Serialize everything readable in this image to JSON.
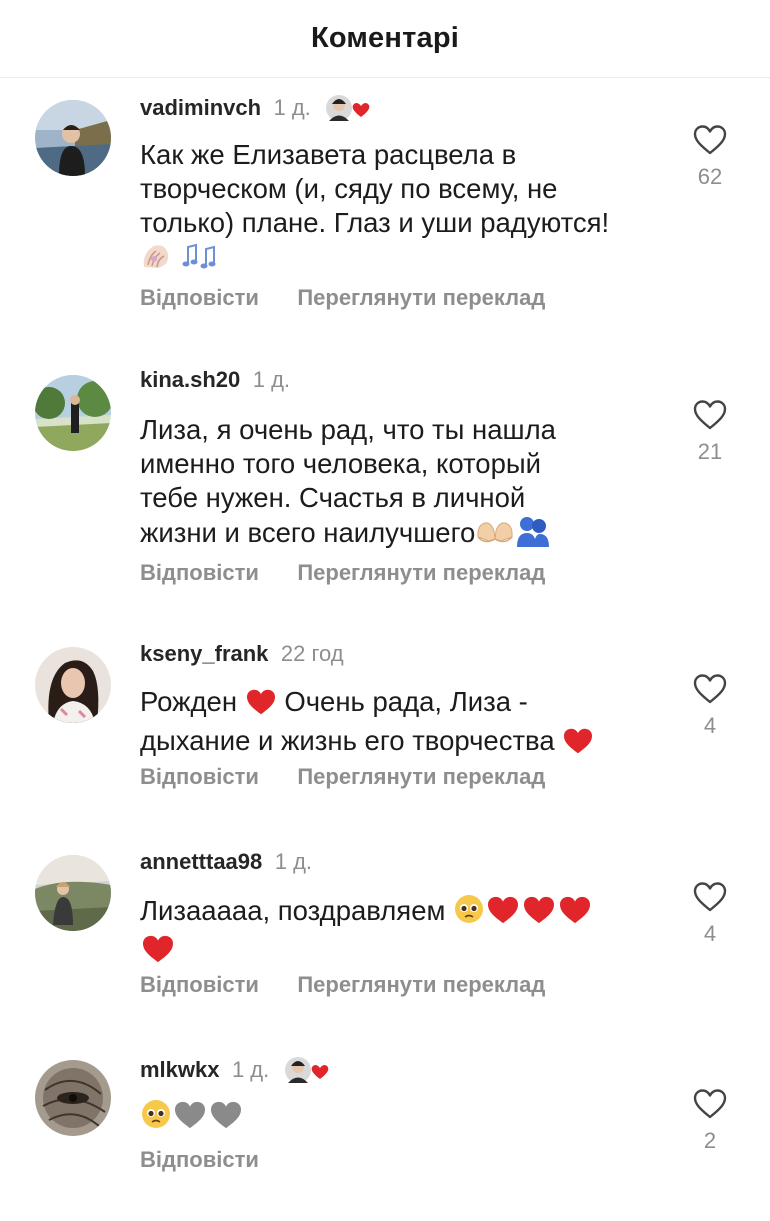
{
  "header": {
    "title": "Коментарі"
  },
  "actions": {
    "reply": "Відповісти",
    "translate": "Переглянути переклад"
  },
  "comments": [
    {
      "username": "vadiminvch",
      "time": "1 д.",
      "author_liked": true,
      "lines": [
        "Как же Елизавета расцвела в",
        "творческом (и, сяду по всему, не",
        "только) плане. Глаз и уши радуются!"
      ],
      "emoji_line": "shell-icon, music-notes-icon",
      "likes": "62",
      "show_translate": true
    },
    {
      "username": "kina.sh20",
      "time": "1 д.",
      "author_liked": false,
      "lines": [
        "Лиза, я очень рад, что ты нашла",
        "именно того человека, который",
        "тебе нужен. Счастья в личной",
        "жизни и всего наилучшего"
      ],
      "likes": "21",
      "show_translate": true
    },
    {
      "username": "kseny_frank",
      "time": "22 год",
      "author_liked": false,
      "lines": [
        "Рожден",
        "Очень рада, Лиза -",
        "дыхание и жизнь его творчества"
      ],
      "likes": "4",
      "show_translate": true
    },
    {
      "username": "annetttaa98",
      "time": "1 д.",
      "author_liked": false,
      "lines": [
        "Лизааааа, поздравляем"
      ],
      "likes": "4",
      "show_translate": true
    },
    {
      "username": "mlkwkx",
      "time": "1 д.",
      "author_liked": true,
      "lines": [],
      "likes": "2",
      "show_translate": false
    }
  ],
  "colors": {
    "heart_red": "#e0262b",
    "muted": "#8e8e8e",
    "text": "#1c1c1c"
  }
}
